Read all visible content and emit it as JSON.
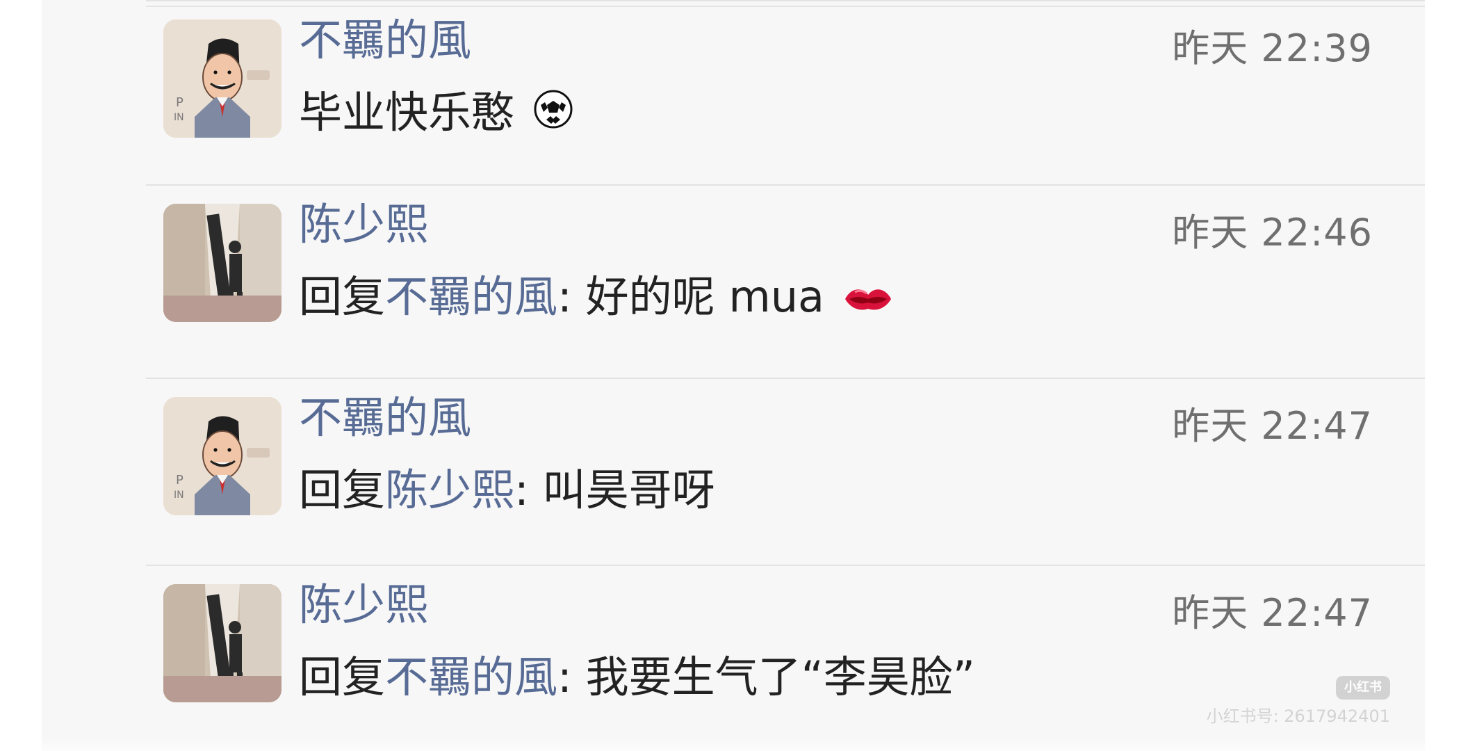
{
  "comments": [
    {
      "username": "不羈的風",
      "timestamp": "昨天 22:39",
      "text": "毕业快乐憨",
      "emoji": "soccer-ball-icon",
      "reply_prefix": "",
      "reply_target": ""
    },
    {
      "username": "陈少熙",
      "timestamp": "昨天 22:46",
      "reply_prefix": "回复",
      "reply_target": "不羈的風",
      "text": ": 好的呢 mua",
      "emoji": "lips-icon"
    },
    {
      "username": "不羈的風",
      "timestamp": "昨天 22:47",
      "reply_prefix": "回复",
      "reply_target": "陈少熙",
      "text": ": 叫昊哥呀",
      "emoji": ""
    },
    {
      "username": "陈少熙",
      "timestamp": "昨天 22:47",
      "reply_prefix": "回复",
      "reply_target": "不羈的風",
      "text": ": 我要生气了“李昊脸”",
      "emoji": ""
    }
  ],
  "watermark": {
    "badge": "小红书",
    "id": "小红书号: 2617942401"
  },
  "colors": {
    "username": "#576b95",
    "timestamp": "#6f6f6f",
    "text": "#222222",
    "background": "#f7f7f7"
  }
}
